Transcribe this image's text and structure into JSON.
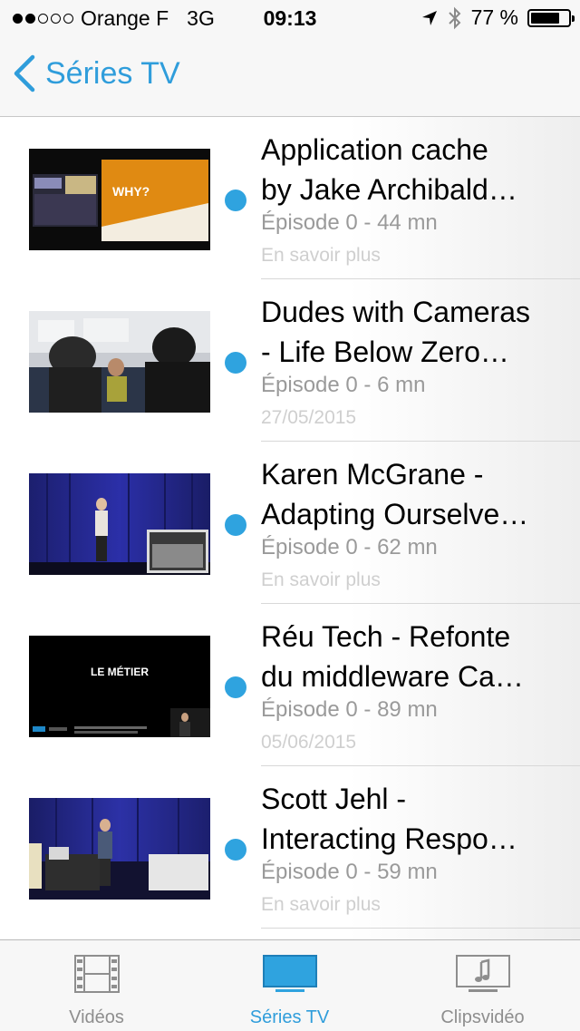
{
  "status": {
    "carrier": "Orange F",
    "network": "3G",
    "time": "09:13",
    "battery": "77 %",
    "battery_level": 0.77
  },
  "nav": {
    "back_label": "Séries TV"
  },
  "episodes": [
    {
      "title_line1": "Application cache",
      "title_line2": "by Jake Archibald…",
      "meta": "Épisode 0 - 44 mn",
      "sub": "En savoir plus"
    },
    {
      "title_line1": "Dudes with Cameras",
      "title_line2": "- Life Below Zero…",
      "meta": "Épisode 0 - 6 mn",
      "sub": "27/05/2015"
    },
    {
      "title_line1": "Karen McGrane -",
      "title_line2": "Adapting Ourselve…",
      "meta": "Épisode 0 - 62 mn",
      "sub": "En savoir plus"
    },
    {
      "title_line1": "Réu Tech - Refonte",
      "title_line2": "du middleware Ca…",
      "meta": "Épisode 0 - 89 mn",
      "sub": "05/06/2015"
    },
    {
      "title_line1": "Scott Jehl -",
      "title_line2": "Interacting Respo…",
      "meta": "Épisode 0 - 59 mn",
      "sub": "En savoir plus"
    }
  ],
  "thumbs": {
    "t1_text": "WHY?",
    "t4_text": "LE MÉTIER"
  },
  "tabs": [
    {
      "label": "Vidéos"
    },
    {
      "label": "Séries TV"
    },
    {
      "label": "Clipsvidéo"
    }
  ],
  "colors": {
    "accent": "#2f9ddb",
    "unread": "#2fa3df"
  }
}
